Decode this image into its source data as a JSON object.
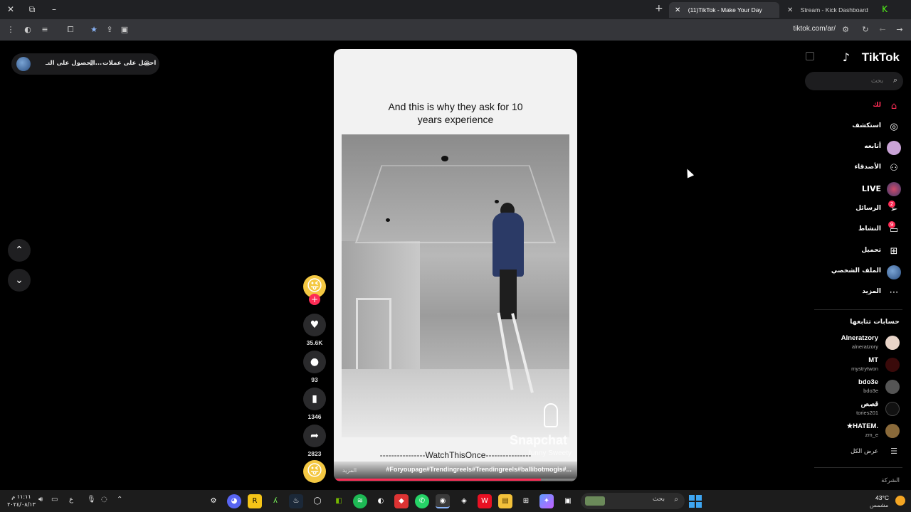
{
  "browser": {
    "tabs": [
      {
        "label": "(11)TikTok - Make Your Day",
        "active": true
      },
      {
        "label": "Stream - Kick Dashboard",
        "active": false
      }
    ],
    "url": "tiktok.com/ar/"
  },
  "promo": {
    "get_coins": "احصل على عملات",
    "get_app": "الحصول على التـ..."
  },
  "video": {
    "caption": "And this is why they ask for 10 years experience",
    "watermark": "Snapchat",
    "watermark_user": "funny Sweety",
    "overlay_text": "----------------WatchThisOnce----------------",
    "hashtags": "#Foryoupage#Trendingreels#Trendingreels#ballibotmogis#...",
    "more_label": "المزيد",
    "progress": 0.85
  },
  "actions": {
    "likes": "35.6K",
    "comments": "93",
    "saves": "1346",
    "shares": "2823"
  },
  "sidebar": {
    "logo": "TikTok",
    "search_placeholder": "بحث",
    "menu": [
      {
        "label": "لك",
        "icon": "home-icon",
        "active": true
      },
      {
        "label": "استكشف",
        "icon": "compass-icon"
      },
      {
        "label": "أتابعه",
        "icon": "avatar-icon"
      },
      {
        "label": "الأصدقاء",
        "icon": "friends-icon"
      },
      {
        "label": "LIVE",
        "icon": "live-icon"
      },
      {
        "label": "الرسائل",
        "icon": "messages-icon",
        "badge": "2"
      },
      {
        "label": "النشاط",
        "icon": "activity-icon",
        "badge": "9"
      },
      {
        "label": "تحميل",
        "icon": "upload-icon"
      },
      {
        "label": "الملف الشخصي",
        "icon": "profile-icon"
      },
      {
        "label": "المزيد",
        "icon": "more-icon"
      }
    ],
    "following_title": "حسابات تتابعها",
    "following": [
      {
        "name": "Alneratzory",
        "handle": "alneratzory"
      },
      {
        "name": "MT",
        "handle": "mystrytwon"
      },
      {
        "name": "bdo3e",
        "handle": "bdo3e"
      },
      {
        "name": "قصص",
        "handle": "tories201"
      },
      {
        "name": "★HATEM.",
        "handle": "zm_e"
      }
    ],
    "see_all": "عرض الكل",
    "company": "الشركة"
  },
  "taskbar": {
    "search_label": "بحث",
    "weather_temp": "43°C",
    "weather_desc": "مشمس",
    "time": "١١:١١ م",
    "date": "٢٠٢٤/٠٨/١٣",
    "lang": "ع"
  }
}
